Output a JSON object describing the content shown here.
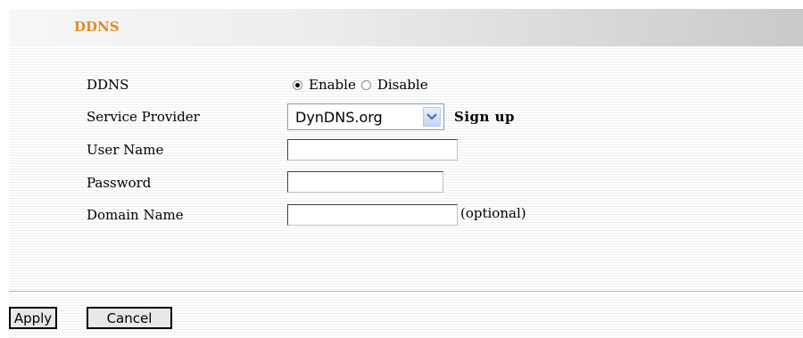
{
  "header": {
    "title": "DDNS"
  },
  "form": {
    "ddns_label": "DDNS",
    "enable_label": "Enable",
    "disable_label": "Disable",
    "selected_mode": "Enable",
    "provider_label": "Service Provider",
    "provider_value": "DynDNS.org",
    "signup_link": "Sign up",
    "username_label": "User Name",
    "username_value": "",
    "password_label": "Password",
    "password_value": "",
    "domain_label": "Domain Name",
    "domain_value": "",
    "optional_note": "(optional)"
  },
  "buttons": {
    "apply_label": "Apply",
    "cancel_label": "Cancel"
  },
  "colors": {
    "header_title": "#e58a1f",
    "select_border": "#7f9db9",
    "dropdown_arrow": "#4a6fb5"
  },
  "icons": {
    "dropdown": "chevron-down-icon"
  }
}
